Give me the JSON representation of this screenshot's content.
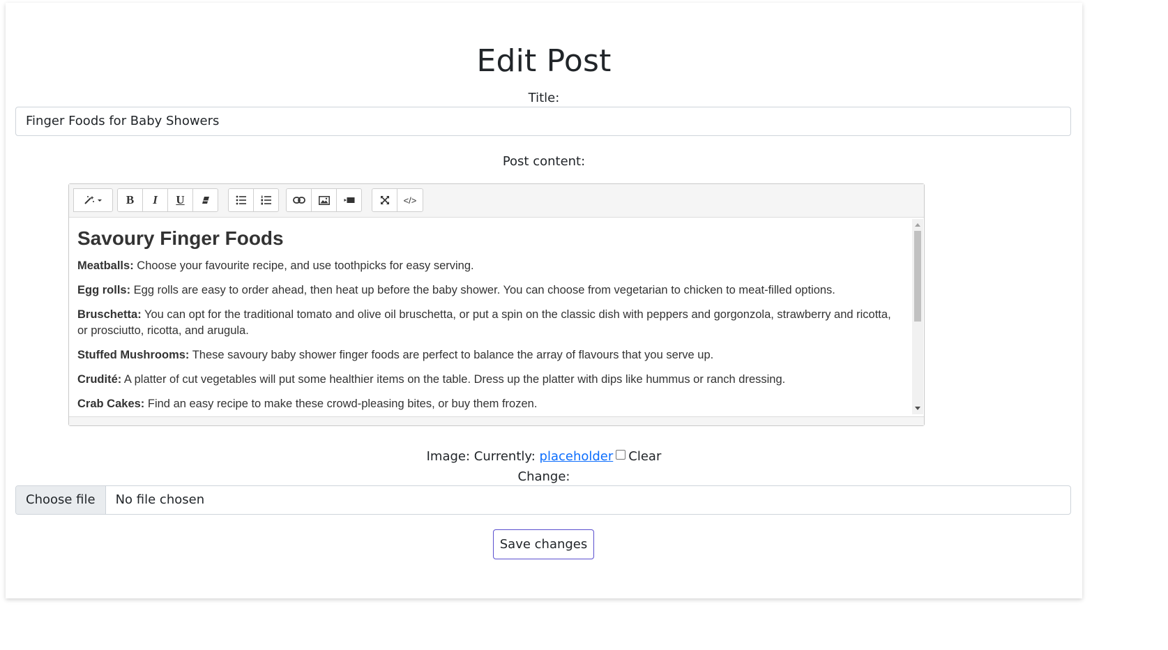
{
  "page": {
    "heading": "Edit Post",
    "title_label": "Title:",
    "title_value": "Finger Foods for Baby Showers",
    "content_label": "Post content:"
  },
  "editor": {
    "toolbar": {
      "style_icon": "magic-wand-icon",
      "bold": "B",
      "italic": "I",
      "underline": "U",
      "eraser_icon": "eraser-icon",
      "ul_icon": "unordered-list-icon",
      "ol_icon": "ordered-list-icon",
      "link_icon": "link-icon",
      "picture_icon": "picture-icon",
      "video_icon": "video-icon",
      "fullscreen_icon": "fullscreen-icon",
      "codeview": "</>"
    },
    "heading": "Savoury Finger Foods",
    "items": [
      {
        "term": "Meatballs:",
        "text": " Choose your favourite recipe, and use toothpicks for easy serving."
      },
      {
        "term": "Egg rolls:",
        "text": " Egg rolls are easy to order ahead, then heat up before the baby shower. You can choose from vegetarian to chicken to meat-filled options."
      },
      {
        "term": "Bruschetta:",
        "text": " You can opt for the traditional tomato and olive oil bruschetta, or put a spin on the classic dish with peppers and gorgonzola, strawberry and ricotta, or prosciutto, ricotta, and arugula."
      },
      {
        "term": "Stuffed Mushrooms:",
        "text": " These savoury baby shower finger foods are perfect to balance the array of flavours that you serve up."
      },
      {
        "term": "Crudité:",
        "text": " A platter of cut vegetables will put some healthier items on the table. Dress up the platter with dips like hummus or ranch dressing."
      },
      {
        "term": "Crab Cakes:",
        "text": " Find an easy recipe to make these crowd-pleasing bites, or buy them frozen."
      }
    ]
  },
  "image": {
    "label": "Image: Currently: ",
    "link": "placeholder",
    "clear_label": "Clear",
    "change_label": "Change:",
    "choose_button": "Choose file",
    "file_status": "No file chosen"
  },
  "save_button": "Save changes"
}
